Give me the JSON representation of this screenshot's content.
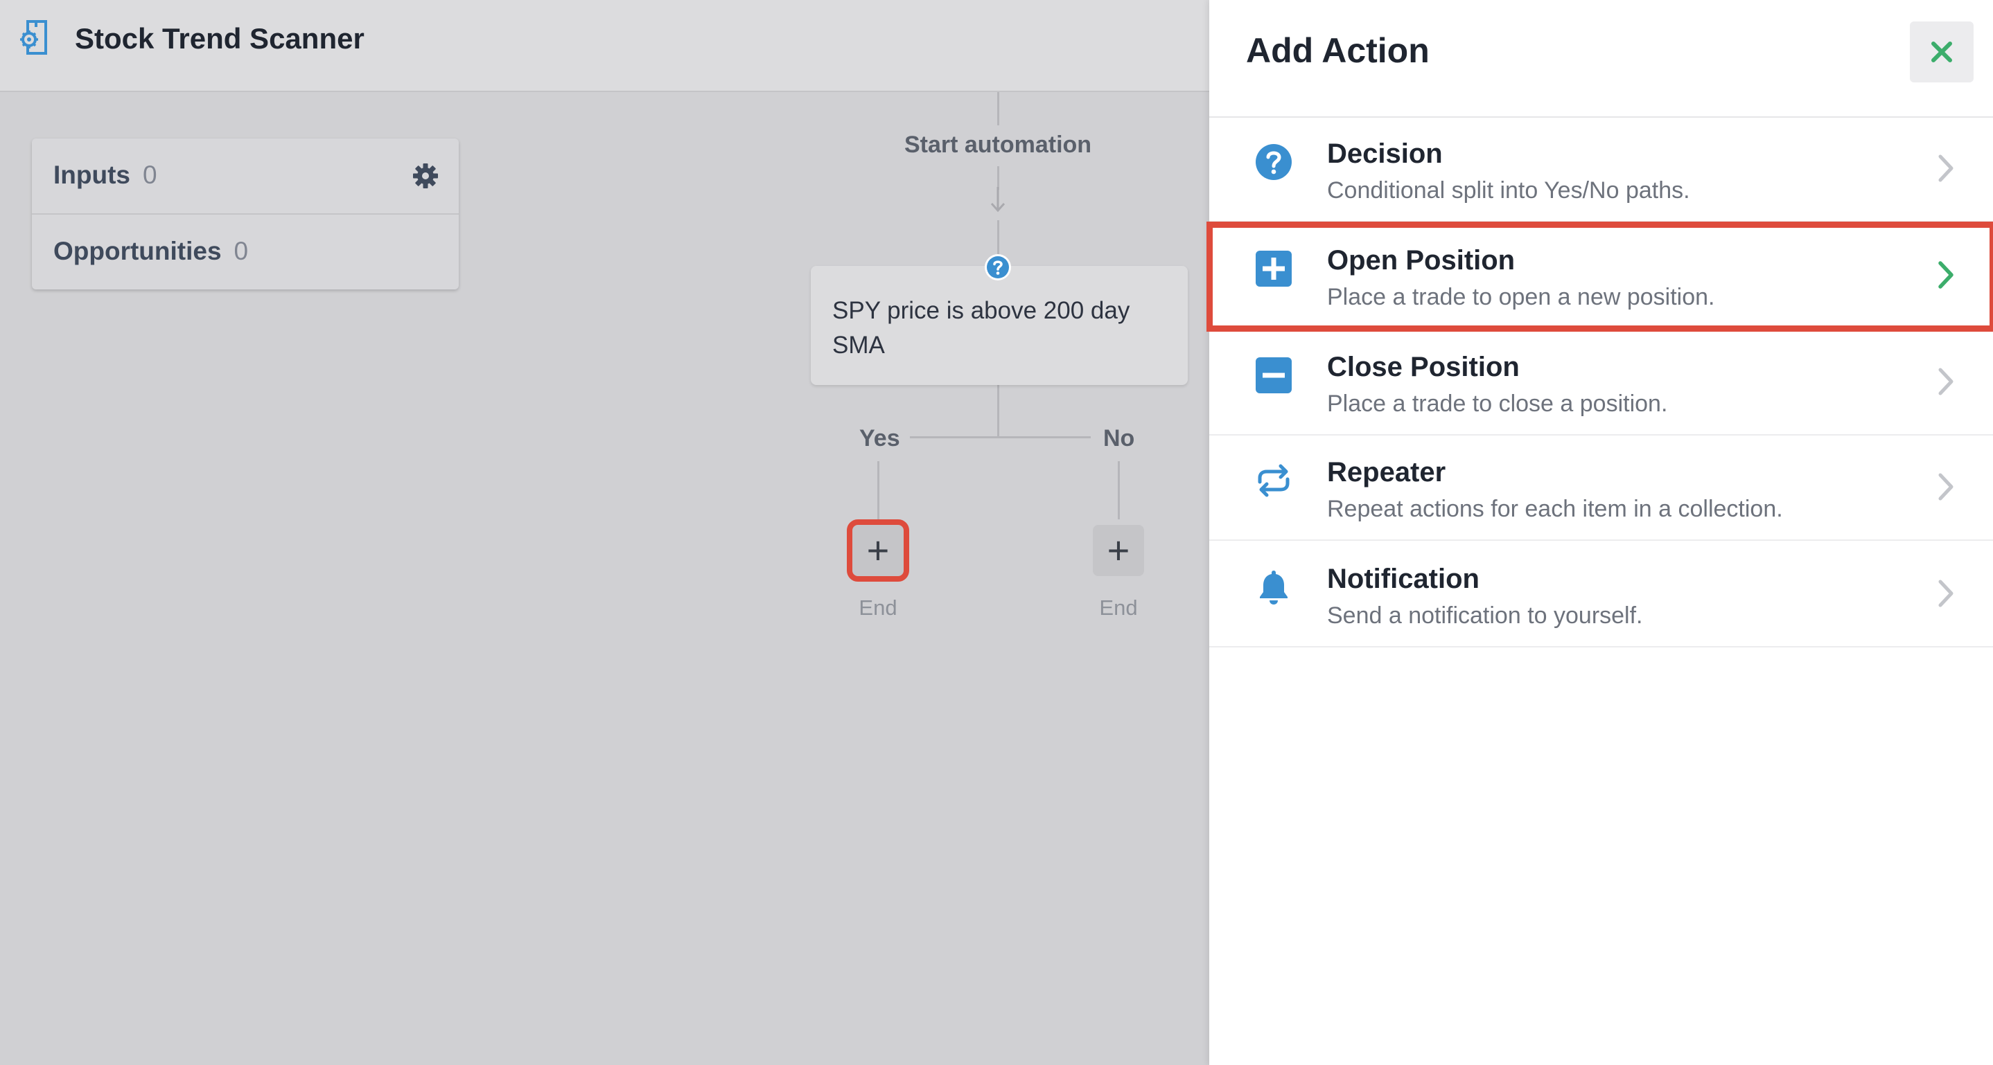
{
  "app": {
    "title": "Stock Trend Scanner",
    "icon": "scanner-gear-doc-icon"
  },
  "stats": {
    "inputs_label": "Inputs",
    "inputs_count": "0",
    "opportunities_label": "Opportunities",
    "opportunities_count": "0"
  },
  "flow": {
    "start_label": "Start automation",
    "decision_text": "SPY price is above 200 day SMA",
    "yes_label": "Yes",
    "no_label": "No",
    "add_symbol": "+",
    "end_label": "End"
  },
  "panel": {
    "title": "Add Action",
    "actions": [
      {
        "name": "Decision",
        "desc": "Conditional split into Yes/No paths.",
        "icon": "question-circle-icon"
      },
      {
        "name": "Open Position",
        "desc": "Place a trade to open a new position.",
        "icon": "plus-square-icon"
      },
      {
        "name": "Close Position",
        "desc": "Place a trade to close a position.",
        "icon": "minus-square-icon"
      },
      {
        "name": "Repeater",
        "desc": "Repeat actions for each item in a collection.",
        "icon": "repeat-arrows-icon"
      },
      {
        "name": "Notification",
        "desc": "Send a notification to yourself.",
        "icon": "bell-icon"
      }
    ]
  },
  "colors": {
    "accent_blue": "#3a8fd0",
    "highlight_red": "#de4b3c",
    "close_green": "#3cad6b",
    "chevron_green": "#3cad6b"
  }
}
